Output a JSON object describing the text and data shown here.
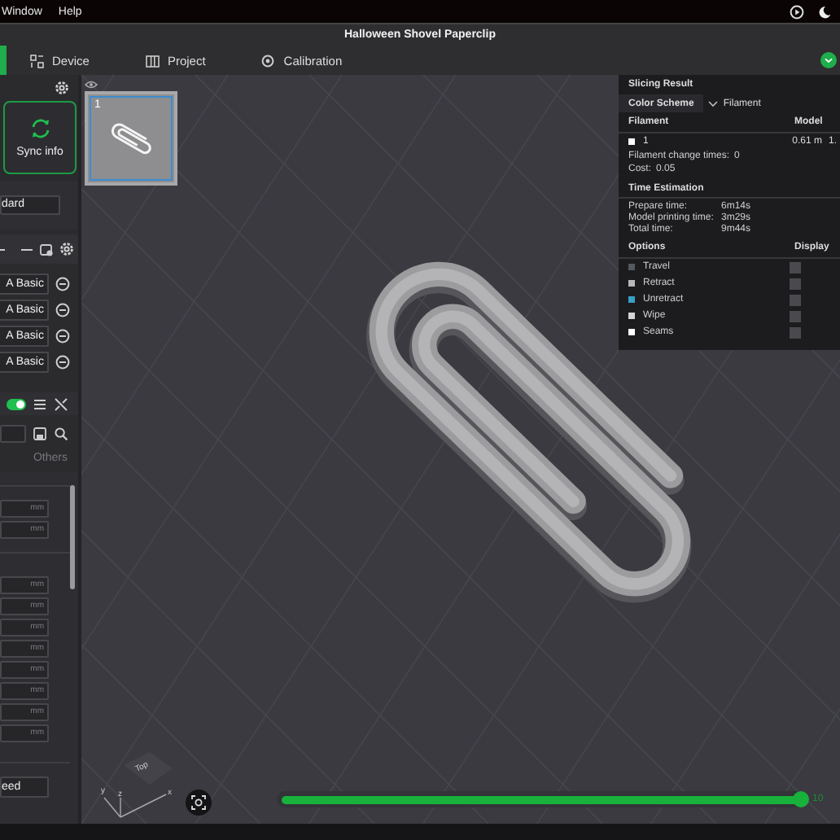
{
  "menu": [
    "Window",
    "Help"
  ],
  "window": {
    "title": "Halloween Shovel Paperclip"
  },
  "tabs": [
    {
      "label": "Device",
      "kind": "device"
    },
    {
      "label": "Project",
      "kind": "project"
    },
    {
      "label": "Calibration",
      "kind": "calibration"
    }
  ],
  "sidebar": {
    "sync_button": "Sync info",
    "preset_value": "dard",
    "filaments": [
      {
        "name": "A Basic"
      },
      {
        "name": "A Basic"
      },
      {
        "name": "A Basic"
      },
      {
        "name": "A Basic"
      }
    ],
    "toggle": {
      "on": true
    },
    "tab": "Others",
    "settings_groups": [
      {
        "fields": [
          {
            "unit": "mm"
          },
          {
            "unit": "mm"
          }
        ]
      },
      {
        "fields": [
          {
            "unit": "mm"
          },
          {
            "unit": "mm"
          },
          {
            "unit": "mm"
          },
          {
            "unit": "mm"
          },
          {
            "unit": "mm"
          },
          {
            "unit": "mm"
          },
          {
            "unit": "mm"
          },
          {
            "unit": "mm"
          }
        ]
      }
    ],
    "bottom_value": "eed"
  },
  "plate": {
    "label": "1"
  },
  "slicing_result": {
    "title": "Slicing Result",
    "color_scheme_label": "Color Scheme",
    "color_scheme_value": "Filament",
    "filament_columns": [
      "Filament",
      "Model"
    ],
    "filament_row": {
      "name": "1",
      "color": "#ffffff",
      "length": "0.61 m",
      "column_3": "1."
    },
    "stats": [
      {
        "label": "Filament change times:",
        "value": "0"
      },
      {
        "label": "Cost:",
        "value": "0.05"
      }
    ],
    "time_title": "Time Estimation",
    "times": [
      {
        "label": "Prepare time:",
        "value": "6m14s"
      },
      {
        "label": "Model printing time:",
        "value": "3m29s"
      },
      {
        "label": "Total time:",
        "value": "9m44s"
      }
    ],
    "options_columns": [
      "Options",
      "Display"
    ],
    "options": [
      {
        "name": "Travel",
        "color": "#55585f",
        "checked": false
      },
      {
        "name": "Retract",
        "color": "#b8b8b8",
        "checked": false
      },
      {
        "name": "Unretract",
        "color": "#3a9fc4",
        "checked": false
      },
      {
        "name": "Wipe",
        "color": "#d4d4d4",
        "checked": false
      },
      {
        "name": "Seams",
        "color": "#ffffff",
        "checked": false
      }
    ]
  },
  "axes": {
    "view": "Top",
    "x": "x",
    "y": "y",
    "z": "z"
  },
  "layer_slider": {
    "level": 1,
    "reading": "10"
  }
}
